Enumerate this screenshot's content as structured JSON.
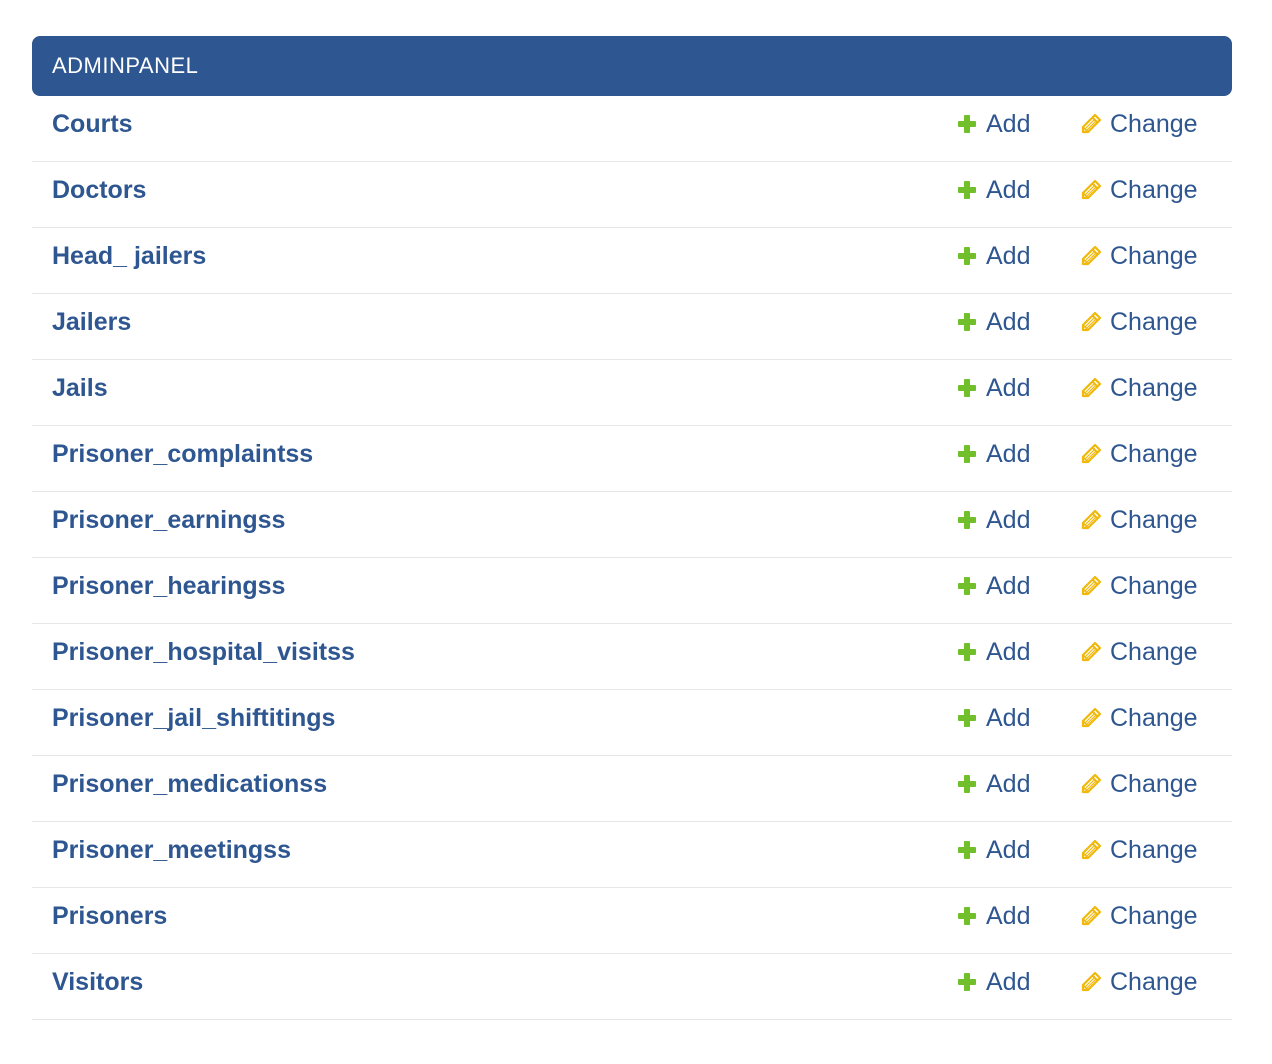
{
  "module": {
    "caption": "ADMINPANEL",
    "add_label": "Add",
    "change_label": "Change",
    "colors": {
      "header_bg": "#2e5690",
      "link": "#2e5690",
      "add_icon": "#70bf2b",
      "change_icon": "#efb80b"
    },
    "rows": [
      {
        "name": "Courts"
      },
      {
        "name": "Doctors"
      },
      {
        "name": "Head_ jailers"
      },
      {
        "name": "Jailers"
      },
      {
        "name": "Jails"
      },
      {
        "name": "Prisoner_complaintss"
      },
      {
        "name": "Prisoner_earningss"
      },
      {
        "name": "Prisoner_hearingss"
      },
      {
        "name": "Prisoner_hospital_visitss"
      },
      {
        "name": "Prisoner_jail_shiftitings"
      },
      {
        "name": "Prisoner_medicationss"
      },
      {
        "name": "Prisoner_meetingss"
      },
      {
        "name": "Prisoners"
      },
      {
        "name": "Visitors"
      }
    ]
  }
}
